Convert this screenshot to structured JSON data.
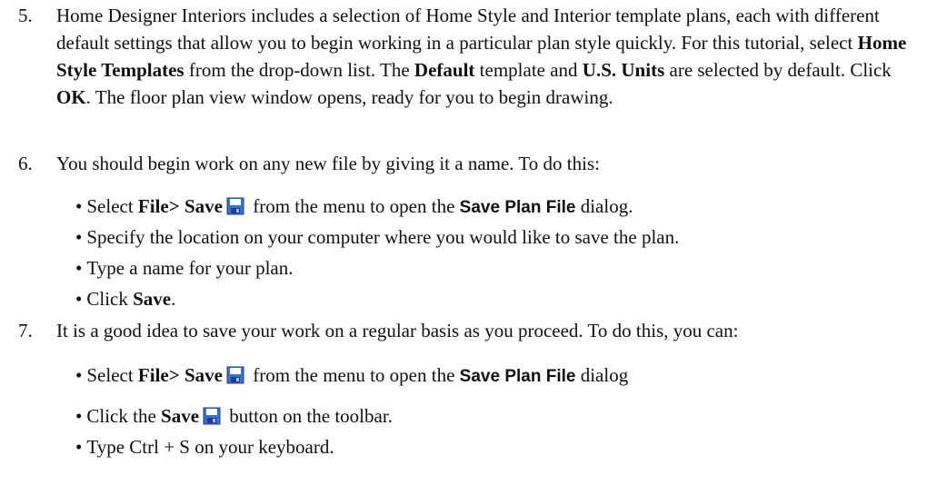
{
  "step5": {
    "number": "5.",
    "t1": "Home Designer Interiors includes a selection of Home Style and Interior template plans, each with different default settings that allow you to begin working in a particular plan style quickly. For this tutorial, select ",
    "b1": "Home Style Templates",
    "t2": " from the drop-down list. The ",
    "b2": "Default",
    "t3": " template and ",
    "b3": "U.S. Units",
    "t4": " are selected by default. Click ",
    "b4": "OK",
    "t5": ". The floor plan view window opens, ready for you to begin drawing."
  },
  "step6": {
    "number": "6.",
    "intro": "You should begin work on any new file by giving it a name. To do this:",
    "bullets": {
      "b1": {
        "t1": "Select ",
        "file": "File",
        "gt": ">",
        "save": " Save",
        "t2": " from the menu to open the ",
        "dialog": "Save Plan File",
        "t3": " dialog."
      },
      "b2": {
        "text": "Specify the location on your computer where you would like to save the plan."
      },
      "b3": {
        "text": "Type a name for your plan."
      },
      "b4": {
        "t1": "Click ",
        "save": "Save",
        "t2": "."
      }
    }
  },
  "step7": {
    "number": "7.",
    "intro": "It is a good idea to save your work on a regular basis as you proceed. To do this, you can:",
    "bullets": {
      "b1": {
        "t1": "Select ",
        "file": "File",
        "gt": ">",
        "save": " Save",
        "t2": " from the menu to open the ",
        "dialog": "Save Plan File",
        "t3": " dialog"
      },
      "b2": {
        "t1": "Click the ",
        "save": "Save",
        "t2": " button on the toolbar."
      },
      "b3": {
        "text": "Type Ctrl + S on your keyboard."
      }
    }
  },
  "bullet_char": "•",
  "icons": {
    "save": "floppy-disk-save-icon"
  },
  "colors": {
    "icon_blue": "#3a6fd1",
    "icon_dark": "#1f3f8a",
    "text": "#111111"
  }
}
